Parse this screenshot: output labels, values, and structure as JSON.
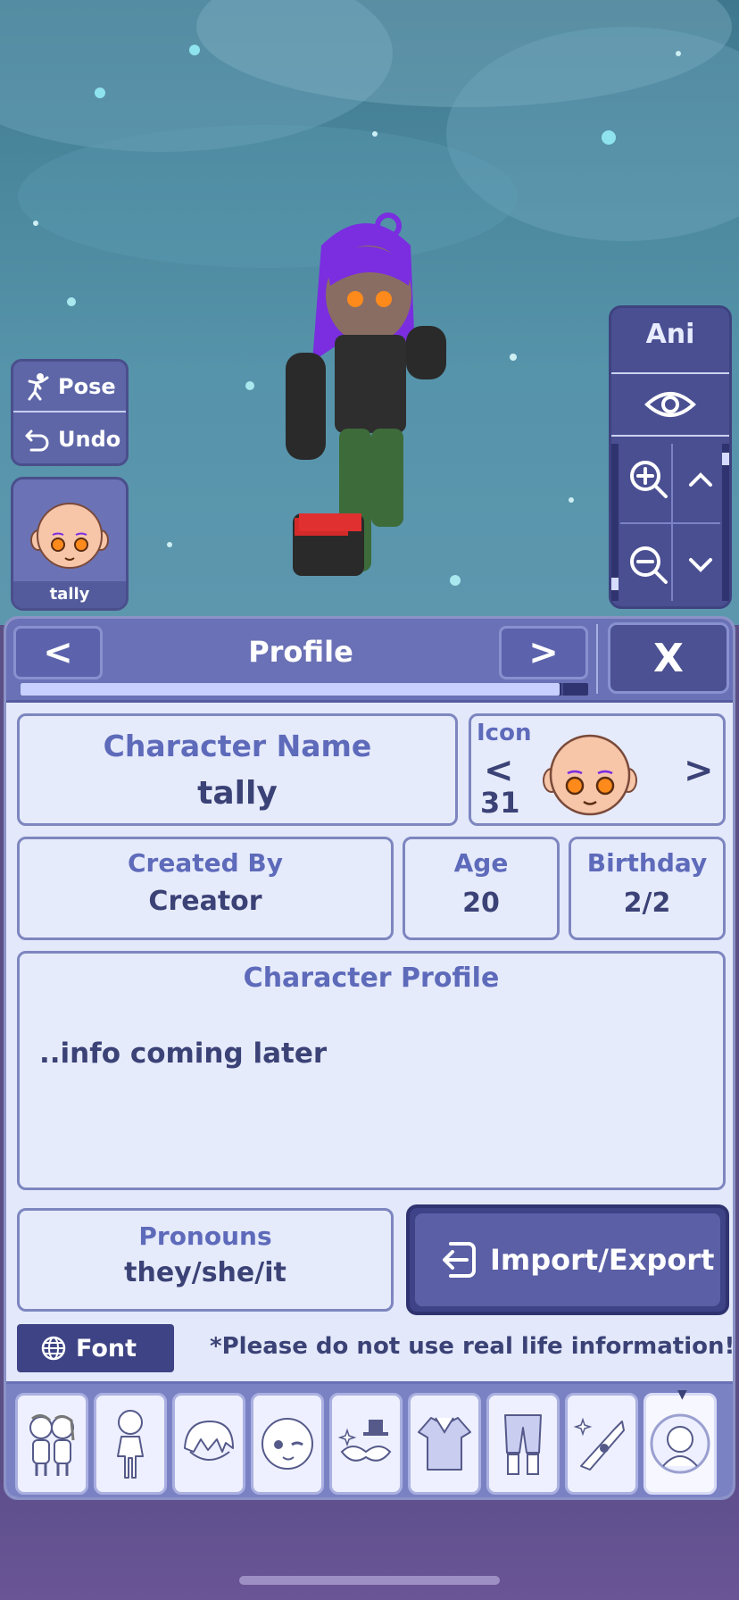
{
  "scene": {
    "pose_label": "Pose",
    "undo_label": "Undo",
    "character_thumb_name": "tally",
    "ani_label": "Ani"
  },
  "panel": {
    "title": "Profile",
    "prev_label": "<",
    "next_label": ">",
    "close_label": "X",
    "progress_fraction": 0.95
  },
  "profile": {
    "name_label": "Character Name",
    "name_value": "tally",
    "icon_label": "Icon",
    "icon_prev": "<",
    "icon_next": ">",
    "icon_number": "31",
    "created_label": "Created By",
    "created_value": "Creator",
    "age_label": "Age",
    "age_value": "20",
    "birthday_label": "Birthday",
    "birthday_value": "2/2",
    "profile_label": "Character Profile",
    "profile_text": "..info coming later",
    "pronouns_label": "Pronouns",
    "pronouns_value": "they/she/it",
    "import_label": "Import/Export",
    "font_label": "Font",
    "warning": "*Please do not use real life information!"
  },
  "tabs": [
    {
      "icon": "characters-icon"
    },
    {
      "icon": "body-icon"
    },
    {
      "icon": "hair-icon"
    },
    {
      "icon": "face-icon"
    },
    {
      "icon": "accessories-icon"
    },
    {
      "icon": "top-clothing-icon"
    },
    {
      "icon": "bottom-clothing-icon"
    },
    {
      "icon": "props-icon"
    },
    {
      "icon": "profile-icon",
      "active": true
    }
  ],
  "colors": {
    "panel_bg": "#e3e8fa",
    "header_bg": "#6b71b6",
    "label": "#5e6aba",
    "value": "#3b4276",
    "button_dark": "#3e4388"
  }
}
